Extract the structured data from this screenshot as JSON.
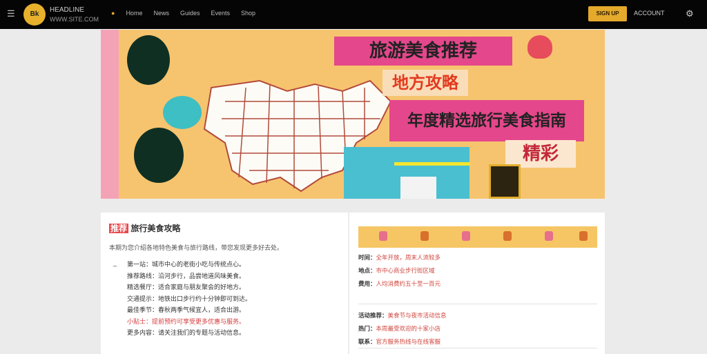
{
  "header": {
    "brand": "HEADLINE",
    "brand_sub": "WWW.SITE.COM",
    "logo_text": "Bk",
    "nav": [
      "Home",
      "News",
      "Guides",
      "Events",
      "Shop"
    ],
    "cta_label": "SIGN UP",
    "account_label": "ACCOUNT",
    "menu_icon": "hamburger-icon",
    "settings_icon": "gear-icon"
  },
  "hero": {
    "sign1": "旅游美食推荐",
    "sign2": "地方攻略",
    "sign3": "年度精选旅行美食指南",
    "sign4": "精彩",
    "colors": {
      "bg": "#f6c46e",
      "pink": "#e4478b",
      "teal": "#49bfd0"
    }
  },
  "article": {
    "title_highlight": "推荐",
    "title_rest": "旅行美食攻略",
    "lead": "本期为您介绍各地特色美食与旅行路线，带您发现更多好去处。",
    "items": [
      "第一站：城市中心的老街小吃与传统点心。",
      "推荐路线：沿河步行，品尝地道风味美食。",
      "精选餐厅：适合家庭与朋友聚会的好地方。",
      "交通提示：地铁出口步行约十分钟即可到达。",
      "最佳季节：春秋两季气候宜人，适合出游。",
      "小贴士：提前预约可享受更多优惠与服务。",
      "更多内容：请关注我们的专题与活动信息。"
    ]
  },
  "sidebar": {
    "rows": [
      {
        "label": "时间：",
        "value": "全年开放，周末人流较多"
      },
      {
        "label": "地点：",
        "value": "市中心商业步行街区域"
      },
      {
        "label": "费用：",
        "value": "人均消费约五十至一百元"
      }
    ],
    "rows2": [
      {
        "label": "活动推荐：",
        "value": "美食节与夜市活动信息"
      },
      {
        "label": "热门：",
        "value": "本周最受欢迎的十家小店"
      },
      {
        "label": "联系：",
        "value": "官方服务热线与在线客服"
      }
    ]
  }
}
